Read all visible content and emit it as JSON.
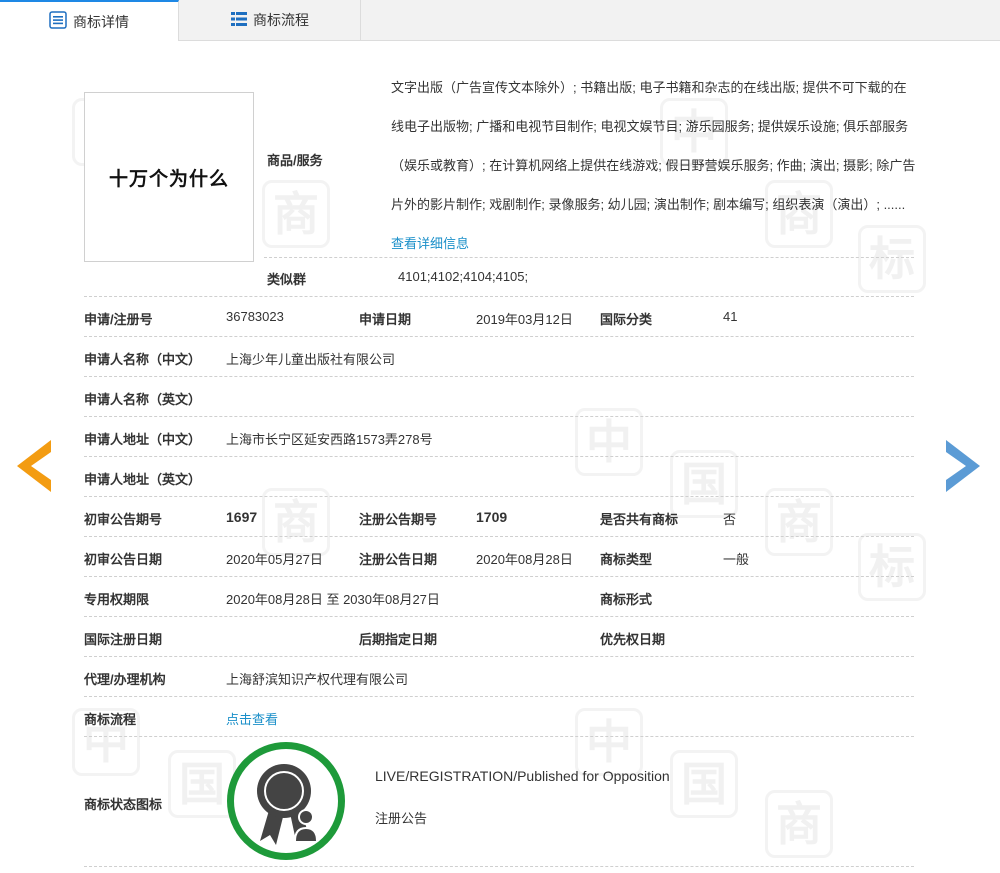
{
  "tabs": [
    {
      "label": "商标详情",
      "icon": "list-detail-icon",
      "active": true
    },
    {
      "label": "商标流程",
      "icon": "grid-list-icon",
      "active": false
    }
  ],
  "logo": {
    "text": "十万个为什么"
  },
  "goods": {
    "label": "商品/服务",
    "text": "文字出版（广告宣传文本除外）; 书籍出版; 电子书籍和杂志的在线出版; 提供不可下载的在线电子出版物; 广播和电视节目制作; 电视文娱节目; 游乐园服务; 提供娱乐设施; 俱乐部服务（娱乐或教育）; 在计算机网络上提供在线游戏; 假日野营娱乐服务; 作曲; 演出; 摄影; 除广告片外的影片制作; 戏剧制作; 录像服务; 幼儿园; 演出制作; 剧本编写; 组织表演（演出）; ......",
    "more_link": "查看详细信息"
  },
  "similar_group": {
    "label": "类似群",
    "value": "4101;4102;4104;4105;"
  },
  "rows": {
    "reg_no_label": "申请/注册号",
    "reg_no": "36783023",
    "app_date_label": "申请日期",
    "app_date": "2019年03月12日",
    "intl_class_label": "国际分类",
    "intl_class": "41",
    "applicant_cn_label": "申请人名称（中文）",
    "applicant_cn": "上海少年儿童出版社有限公司",
    "applicant_en_label": "申请人名称（英文）",
    "applicant_en": "",
    "address_cn_label": "申请人地址（中文）",
    "address_cn": "上海市长宁区延安西路1573弄278号",
    "address_en_label": "申请人地址（英文）",
    "address_en": "",
    "prelim_no_label": "初审公告期号",
    "prelim_no": "1697",
    "reg_pub_no_label": "注册公告期号",
    "reg_pub_no": "1709",
    "shared_label": "是否共有商标",
    "shared": "否",
    "prelim_date_label": "初审公告日期",
    "prelim_date": "2020年05月27日",
    "reg_pub_date_label": "注册公告日期",
    "reg_pub_date": "2020年08月28日",
    "mark_type_label": "商标类型",
    "mark_type": "一般",
    "exclusive_label": "专用权期限",
    "exclusive": "2020年08月28日 至 2030年08月27日",
    "mark_form_label": "商标形式",
    "mark_form": "",
    "intl_reg_date_label": "国际注册日期",
    "intl_reg_date": "",
    "later_date_label": "后期指定日期",
    "later_date": "",
    "priority_label": "优先权日期",
    "priority": "",
    "agent_label": "代理/办理机构",
    "agent": "上海舒滨知识产权代理有限公司",
    "flow_label": "商标流程",
    "flow_link": "点击查看",
    "status_icon_label": "商标状态图标"
  },
  "status": {
    "en": "LIVE/REGISTRATION/Published for Opposition",
    "cn": "注册公告"
  },
  "watermark": {
    "glyphs": [
      "中",
      "国",
      "商",
      "标"
    ]
  },
  "colors": {
    "accent": "#1e88e5",
    "link": "#1a8fc9",
    "arrow_left": "#f39c12",
    "arrow_right": "#5b9bd5",
    "status_ring": "#1e9a3a"
  }
}
